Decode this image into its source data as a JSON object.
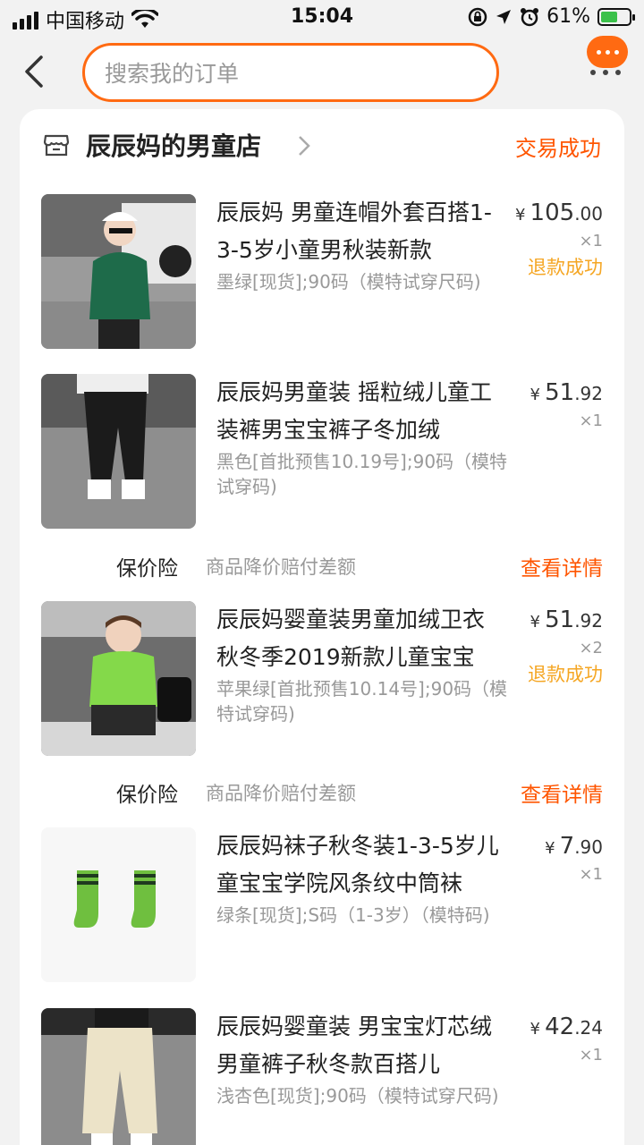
{
  "status_bar": {
    "carrier": "中国移动",
    "time": "15:04",
    "battery_percent": "61%",
    "battery_level": 0.61
  },
  "search": {
    "placeholder": "搜索我的订单"
  },
  "shop": {
    "name": "辰辰妈的男童店",
    "status": "交易成功"
  },
  "items": [
    {
      "title": "辰辰妈 男童连帽外套百搭1-3-5岁小童男秋装新款",
      "spec": "墨绿[现货];90码（模特试穿尺码)",
      "price_int": "105",
      "price_dec": ".00",
      "qty": "×1",
      "refund": "退款成功"
    },
    {
      "title": "辰辰妈男童装 摇粒绒儿童工装裤男宝宝裤子冬加绒",
      "spec": "黑色[首批预售10.19号];90码（模特试穿码)",
      "price_int": "51",
      "price_dec": ".92",
      "qty": "×1",
      "refund": ""
    },
    {
      "title": "辰辰妈婴童装男童加绒卫衣秋冬季2019新款儿童宝宝",
      "spec": "苹果绿[首批预售10.14号];90码（模特试穿码)",
      "price_int": "51",
      "price_dec": ".92",
      "qty": "×2",
      "refund": "退款成功"
    },
    {
      "title": "辰辰妈袜子秋冬装1-3-5岁儿童宝宝学院风条纹中筒袜",
      "spec": "绿条[现货];S码（1-3岁）（模特码)",
      "price_int": "7",
      "price_dec": ".90",
      "qty": "×1",
      "refund": ""
    },
    {
      "title": "辰辰妈婴童装 男宝宝灯芯绒男童裤子秋冬款百搭儿",
      "spec": "浅杏色[现货];90码（模特试穿尺码)",
      "price_int": "42",
      "price_dec": ".24",
      "qty": "×1",
      "refund": ""
    }
  ],
  "currency_symbol": "¥",
  "insurance": {
    "label": "保价险",
    "description": "商品降价赔付差额",
    "link": "查看详情"
  },
  "colors": {
    "accent": "#ff5500",
    "refund": "#f5a623",
    "search_border": "#ff6a12"
  },
  "icons": [
    "back-icon",
    "more-icon",
    "shop-icon",
    "chevron-right-icon",
    "signal-icon",
    "wifi-icon",
    "lock-rotation-icon",
    "location-icon",
    "alarm-icon",
    "battery-icon"
  ]
}
